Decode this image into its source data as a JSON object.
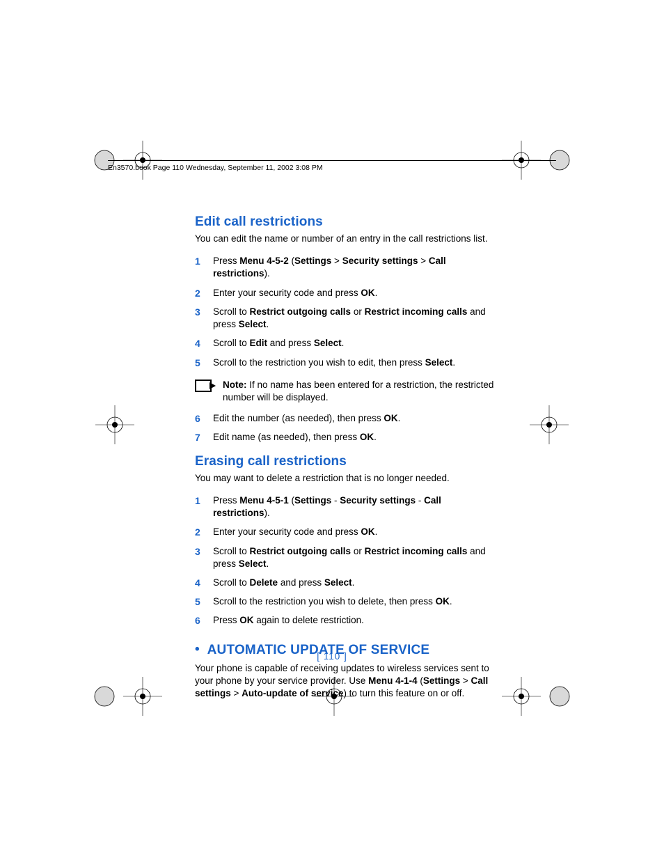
{
  "header": {
    "running": "En3570.book  Page 110  Wednesday, September 11, 2002  3:08 PM"
  },
  "section1": {
    "title": "Edit call restrictions",
    "intro": "You can edit the name or number of an entry in the call restrictions list.",
    "steps": {
      "s1a": "Press ",
      "s1b": "Menu 4-5-2",
      "s1c": " (",
      "s1d": "Settings",
      "s1e": " > ",
      "s1f": "Security settings",
      "s1g": " > ",
      "s1h": "Call restrictions",
      "s1i": ").",
      "s2a": "Enter your security code and press ",
      "s2b": "OK",
      "s2c": ".",
      "s3a": "Scroll to ",
      "s3b": "Restrict outgoing calls",
      "s3c": " or ",
      "s3d": "Restrict incoming calls",
      "s3e": " and press ",
      "s3f": "Select",
      "s3g": ".",
      "s4a": "Scroll to ",
      "s4b": "Edit",
      "s4c": " and press ",
      "s4d": "Select",
      "s4e": ".",
      "s5a": "Scroll to the restriction you wish to edit, then press ",
      "s5b": "Select",
      "s5c": "."
    },
    "note": {
      "lead": "Note:",
      "body": " If no name has been entered for a restriction, the restricted number will be displayed."
    },
    "steps2": {
      "s6a": "Edit the number (as needed), then press ",
      "s6b": "OK",
      "s6c": ".",
      "s7a": "Edit name (as needed), then press ",
      "s7b": "OK",
      "s7c": "."
    }
  },
  "section2": {
    "title": "Erasing call restrictions",
    "intro": "You may want to delete a restriction that is no longer needed.",
    "steps": {
      "s1a": "Press ",
      "s1b": "Menu 4-5-1",
      "s1c": " (",
      "s1d": "Settings",
      "s1e": " - ",
      "s1f": "Security settings",
      "s1g": " - ",
      "s1h": "Call restrictions",
      "s1i": ").",
      "s2a": "Enter your security code and press ",
      "s2b": "OK",
      "s2c": ".",
      "s3a": "Scroll to ",
      "s3b": "Restrict outgoing calls",
      "s3c": " or ",
      "s3d": "Restrict incoming calls",
      "s3e": " and press ",
      "s3f": "Select",
      "s3g": ".",
      "s4a": "Scroll to ",
      "s4b": "Delete",
      "s4c": " and press ",
      "s4d": "Select",
      "s4e": ".",
      "s5a": "Scroll to the restriction you wish to delete, then press ",
      "s5b": "OK",
      "s5c": ".",
      "s6a": "Press ",
      "s6b": "OK",
      "s6c": " again to delete restriction."
    }
  },
  "section3": {
    "title": "AUTOMATIC UPDATE OF SERVICE",
    "body": {
      "a": "Your phone is capable of receiving updates to wireless services sent to your phone by your service provider. Use ",
      "b": "Menu 4-1-4",
      "c": " (",
      "d": "Settings",
      "e": " > ",
      "f": "Call settings",
      "g": " > ",
      "h": "Auto-update of service",
      "i": ") to turn this feature on or off."
    }
  },
  "page_number": "[ 110 ]"
}
